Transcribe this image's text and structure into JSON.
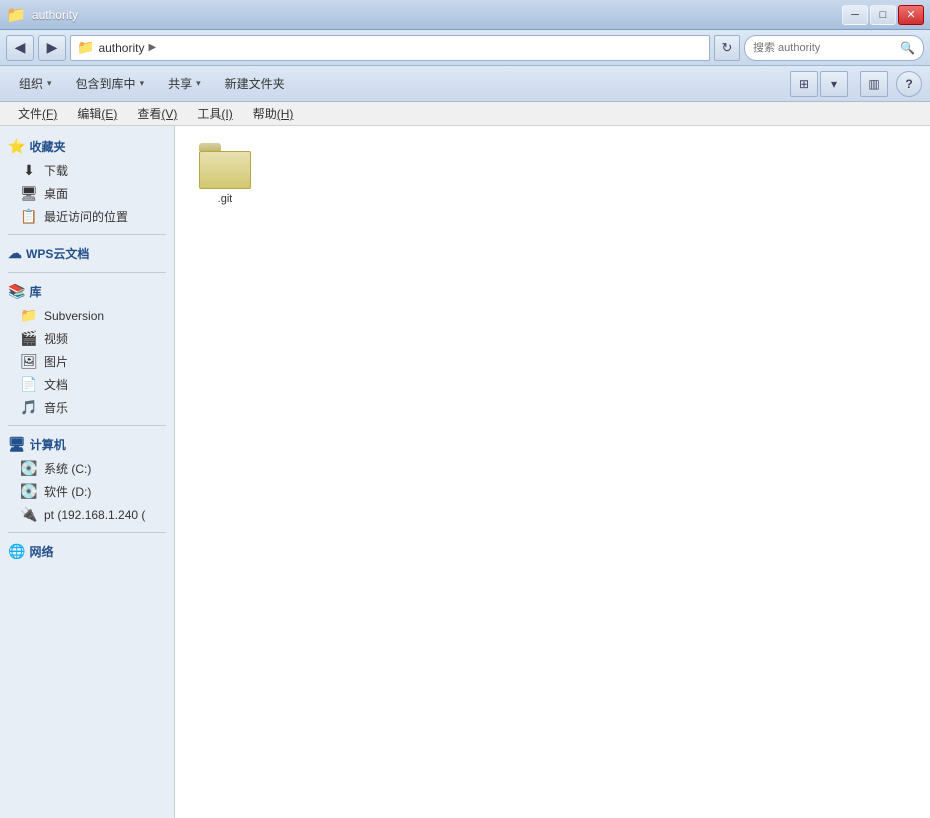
{
  "titlebar": {
    "title": "authority",
    "icon": "📁",
    "controls": {
      "minimize": "─",
      "maximize": "□",
      "close": "✕"
    }
  },
  "addressbar": {
    "back_title": "后退",
    "forward_title": "前进",
    "path_icon": "📁",
    "path": "authority",
    "path_arrow": "▶",
    "refresh": "↻",
    "search_placeholder": "搜索 authority"
  },
  "toolbar": {
    "organize_label": "组织",
    "include_label": "包含到库中",
    "share_label": "共享",
    "new_folder_label": "新建文件夹",
    "dropdown_arrow": "▾"
  },
  "menubar": {
    "items": [
      {
        "id": "file",
        "label": "文件(F)",
        "underline_index": 2
      },
      {
        "id": "edit",
        "label": "编辑(E)",
        "underline_index": 2
      },
      {
        "id": "view",
        "label": "查看(V)",
        "underline_index": 2
      },
      {
        "id": "tools",
        "label": "工具(I)",
        "underline_index": 2
      },
      {
        "id": "help",
        "label": "帮助(H)",
        "underline_index": 2
      }
    ]
  },
  "sidebar": {
    "favorites_header": "收藏夹",
    "favorites_items": [
      {
        "id": "downloads",
        "label": "下载",
        "icon": "⬇"
      },
      {
        "id": "desktop",
        "label": "桌面",
        "icon": "🖥"
      },
      {
        "id": "recent",
        "label": "最近访问的位置",
        "icon": "📋"
      }
    ],
    "wps_header": "WPS云文档",
    "wps_icon": "☁",
    "library_header": "库",
    "library_items": [
      {
        "id": "subversion",
        "label": "Subversion",
        "icon": "📁"
      },
      {
        "id": "videos",
        "label": "视频",
        "icon": "🎬"
      },
      {
        "id": "images",
        "label": "图片",
        "icon": "🖼"
      },
      {
        "id": "documents",
        "label": "文档",
        "icon": "📄"
      },
      {
        "id": "music",
        "label": "音乐",
        "icon": "🎵"
      }
    ],
    "computer_header": "计算机",
    "computer_items": [
      {
        "id": "systemc",
        "label": "系统 (C:)",
        "icon": "💽"
      },
      {
        "id": "softd",
        "label": "软件 (D:)",
        "icon": "💽"
      },
      {
        "id": "network_drive",
        "label": "pt (192.168.1.240 (",
        "icon": "🔌"
      }
    ],
    "network_header": "网络",
    "network_icon": "🌐"
  },
  "filearea": {
    "files": [
      {
        "id": "git-folder",
        "name": ".git",
        "type": "hidden-folder"
      }
    ]
  }
}
